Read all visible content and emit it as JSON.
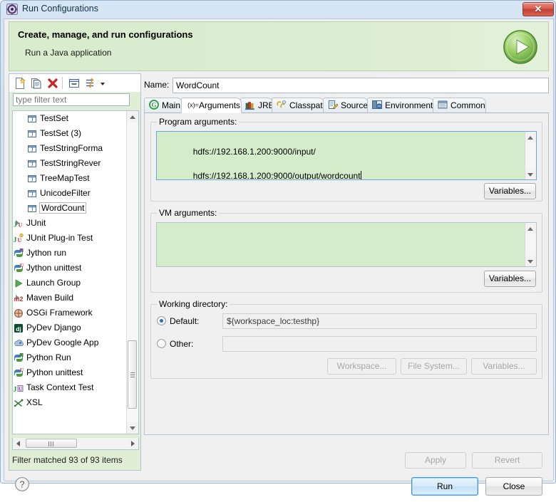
{
  "window": {
    "title": "Run Configurations",
    "title_icon": "run-configurations-icon",
    "close_label": "✕"
  },
  "banner": {
    "title": "Create, manage, and run configurations",
    "subtitle": "Run a Java application",
    "icon": "run-green-play-icon"
  },
  "tree_toolbar": {
    "buttons": [
      {
        "name": "new-launch-configuration",
        "icon": "new-document-icon"
      },
      {
        "name": "duplicate-launch-configuration",
        "icon": "copy-document-icon"
      },
      {
        "name": "delete-launch-configuration",
        "icon": "delete-red-x-icon"
      },
      {
        "name": "collapse-all",
        "icon": "collapse-all-icon"
      },
      {
        "name": "filter-launch-configurations",
        "icon": "filter-icon"
      },
      {
        "name": "toolbar-menu",
        "icon": "chevron-down-icon"
      }
    ]
  },
  "filter": {
    "placeholder": "type filter text",
    "value": "",
    "status": "Filter matched 93 of 93 items"
  },
  "tree": {
    "items": [
      {
        "label": "TestSet",
        "icon": "java-application-icon",
        "level": 2,
        "expandable": false,
        "selected": false
      },
      {
        "label": "TestSet (3)",
        "icon": "java-application-icon",
        "level": 2,
        "expandable": false,
        "selected": false
      },
      {
        "label": "TestStringForma",
        "icon": "java-application-icon",
        "level": 2,
        "expandable": false,
        "selected": false
      },
      {
        "label": "TestStringRever",
        "icon": "java-application-icon",
        "level": 2,
        "expandable": false,
        "selected": false
      },
      {
        "label": "TreeMapTest",
        "icon": "java-application-icon",
        "level": 2,
        "expandable": false,
        "selected": false
      },
      {
        "label": "UnicodeFilter",
        "icon": "java-application-icon",
        "level": 2,
        "expandable": false,
        "selected": false
      },
      {
        "label": "WordCount",
        "icon": "java-application-icon",
        "level": 2,
        "expandable": false,
        "selected": true
      },
      {
        "label": "JUnit",
        "icon": "junit-icon",
        "level": 1,
        "expandable": true,
        "selected": false
      },
      {
        "label": "JUnit Plug-in Test",
        "icon": "junit-plugin-icon",
        "level": 1,
        "expandable": false,
        "selected": false
      },
      {
        "label": "Jython run",
        "icon": "jython-icon",
        "level": 1,
        "expandable": false,
        "selected": false
      },
      {
        "label": "Jython unittest",
        "icon": "jython-unittest-icon",
        "level": 1,
        "expandable": false,
        "selected": false
      },
      {
        "label": "Launch Group",
        "icon": "launch-group-icon",
        "level": 1,
        "expandable": false,
        "selected": false
      },
      {
        "label": "Maven Build",
        "icon": "maven-icon",
        "level": 1,
        "expandable": true,
        "selected": false
      },
      {
        "label": "OSGi Framework",
        "icon": "osgi-icon",
        "level": 1,
        "expandable": false,
        "selected": false
      },
      {
        "label": "PyDev Django",
        "icon": "django-icon",
        "level": 1,
        "expandable": false,
        "selected": false
      },
      {
        "label": "PyDev Google App",
        "icon": "google-app-engine-icon",
        "level": 1,
        "expandable": false,
        "selected": false
      },
      {
        "label": "Python Run",
        "icon": "python-run-icon",
        "level": 1,
        "expandable": false,
        "selected": false
      },
      {
        "label": "Python unittest",
        "icon": "python-unittest-icon",
        "level": 1,
        "expandable": false,
        "selected": false
      },
      {
        "label": "Task Context Test",
        "icon": "task-context-test-icon",
        "level": 1,
        "expandable": false,
        "selected": false
      },
      {
        "label": "XSL",
        "icon": "xsl-icon",
        "level": 1,
        "expandable": false,
        "selected": false
      }
    ]
  },
  "config": {
    "name_label": "Name:",
    "name_value": "WordCount",
    "tabs": [
      {
        "label": "Main",
        "icon": "main-green-g-icon",
        "active": false
      },
      {
        "label": "Arguments",
        "icon": "arguments-xeq-icon",
        "active": true
      },
      {
        "label": "JRE",
        "icon": "jre-books-icon",
        "active": false
      },
      {
        "label": "Classpath",
        "icon": "classpath-clips-icon",
        "active": false
      },
      {
        "label": "Source",
        "icon": "source-pencil-icon",
        "active": false
      },
      {
        "label": "Environment",
        "icon": "environment-icon",
        "active": false
      },
      {
        "label": "Common",
        "icon": "common-icon",
        "active": false
      }
    ]
  },
  "program_arguments": {
    "group_label": "Program arguments:",
    "value": "hdfs://192.168.1.200:9000/input/\nhdfs://192.168.1.200:9000/output/wordcount",
    "lines": [
      "hdfs://192.168.1.200:9000/input/",
      "hdfs://192.168.1.200:9000/output/wordcount"
    ],
    "variables_button": "Variables..."
  },
  "vm_arguments": {
    "group_label": "VM arguments:",
    "value": "",
    "variables_button": "Variables..."
  },
  "working_directory": {
    "group_label": "Working directory:",
    "default_label": "Default:",
    "default_value": "${workspace_loc:testhp}",
    "default_selected": true,
    "other_label": "Other:",
    "other_value": "",
    "other_selected": false,
    "workspace_button": "Workspace...",
    "filesystem_button": "File System...",
    "variables_button": "Variables..."
  },
  "actions": {
    "apply": "Apply",
    "apply_enabled": false,
    "revert": "Revert",
    "revert_enabled": false,
    "run": "Run",
    "close": "Close",
    "help_icon": "help-question-icon"
  },
  "colors": {
    "banner_green": "#d9ecce",
    "field_green": "#d5ecca",
    "accent_blue": "#3c9ad6",
    "close_red": "#c03f31",
    "run_green": "#7dbd4a"
  }
}
